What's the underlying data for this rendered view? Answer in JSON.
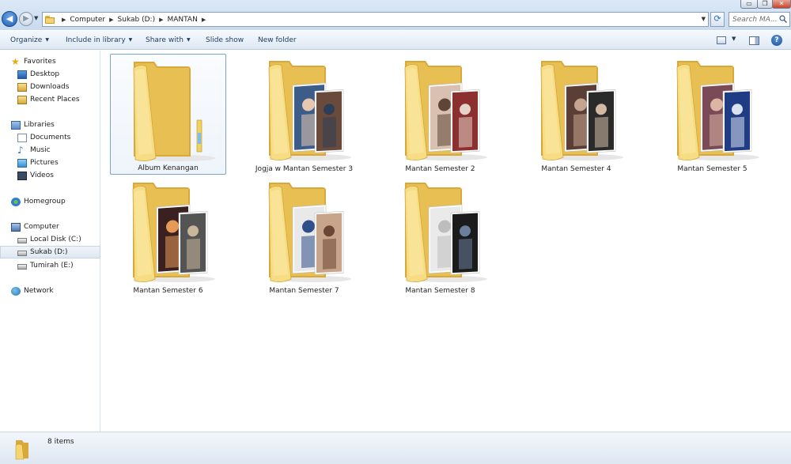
{
  "window": {
    "controls": {
      "minimize": "▭",
      "maximize": "❐",
      "close": "✕"
    }
  },
  "address": {
    "crumbs": [
      "Computer",
      "Sukab (D:)",
      "MANTAN"
    ]
  },
  "search": {
    "placeholder": "Search MA..."
  },
  "toolbar": {
    "organize": "Organize",
    "include_in_library": "Include in library",
    "share_with": "Share with",
    "slide_show": "Slide show",
    "new_folder": "New folder"
  },
  "sidebar": {
    "favorites": {
      "label": "Favorites",
      "items": [
        "Desktop",
        "Downloads",
        "Recent Places"
      ]
    },
    "libraries": {
      "label": "Libraries",
      "items": [
        "Documents",
        "Music",
        "Pictures",
        "Videos"
      ]
    },
    "homegroup": {
      "label": "Homegroup"
    },
    "computer": {
      "label": "Computer",
      "items": [
        "Local Disk (C:)",
        "Sukab (D:)",
        "Tumirah (E:)"
      ]
    },
    "network": {
      "label": "Network"
    }
  },
  "folders": [
    {
      "name": "Album Kenangan",
      "photos": 0
    },
    {
      "name": "Jogja w Mantan Semester 3",
      "photos": 2
    },
    {
      "name": "Mantan Semester 2",
      "photos": 2
    },
    {
      "name": "Mantan Semester 4",
      "photos": 2
    },
    {
      "name": "Mantan Semester 5",
      "photos": 2
    },
    {
      "name": "Mantan Semester 6",
      "photos": 2
    },
    {
      "name": "Mantan Semester 7",
      "photos": 2
    },
    {
      "name": "Mantan Semester 8",
      "photos": 2
    }
  ],
  "status": {
    "item_count": "8 items"
  },
  "colors": {
    "selection_border": "#7da2ce",
    "folder_yellow": "#f4d574",
    "folder_dark": "#d9a83a",
    "chrome": "#dbe8f6"
  }
}
